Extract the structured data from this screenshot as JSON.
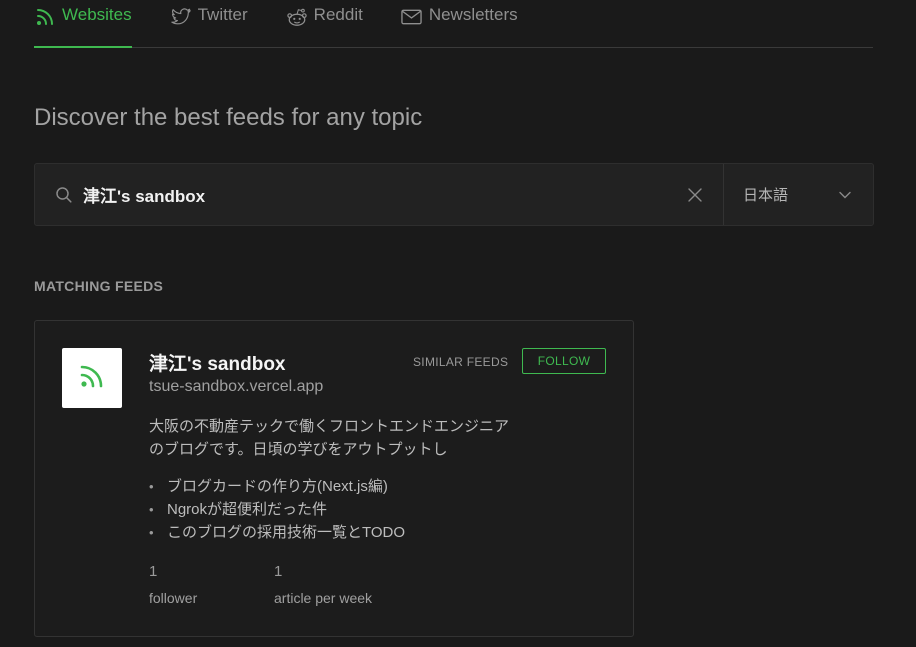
{
  "tabs": [
    {
      "label": "Websites",
      "icon": "rss-icon",
      "active": true
    },
    {
      "label": "Twitter",
      "icon": "twitter-icon",
      "active": false
    },
    {
      "label": "Reddit",
      "icon": "reddit-icon",
      "active": false
    },
    {
      "label": "Newsletters",
      "icon": "mail-icon",
      "active": false
    }
  ],
  "headline": "Discover the best feeds for any topic",
  "search": {
    "value": "津江's sandbox",
    "placeholder": "",
    "language": "日本語"
  },
  "section_label": "MATCHING FEEDS",
  "feed": {
    "title": "津江's sandbox",
    "url": "tsue-sandbox.vercel.app",
    "similar_label": "SIMILAR FEEDS",
    "follow_label": "FOLLOW",
    "description": "大阪の不動産テックで働くフロントエンドエンジニアのブログです。日頃の学びをアウトプットし",
    "articles": [
      "ブログカードの作り方(Next.js編)",
      "Ngrokが超便利だった件",
      "このブログの採用技術一覧とTODO"
    ],
    "followers_count": "1",
    "followers_label": "follower",
    "articles_per_week_count": "1",
    "articles_per_week_label": "article per week"
  },
  "colors": {
    "accent": "#3fb950",
    "background": "#1a1a1a"
  }
}
